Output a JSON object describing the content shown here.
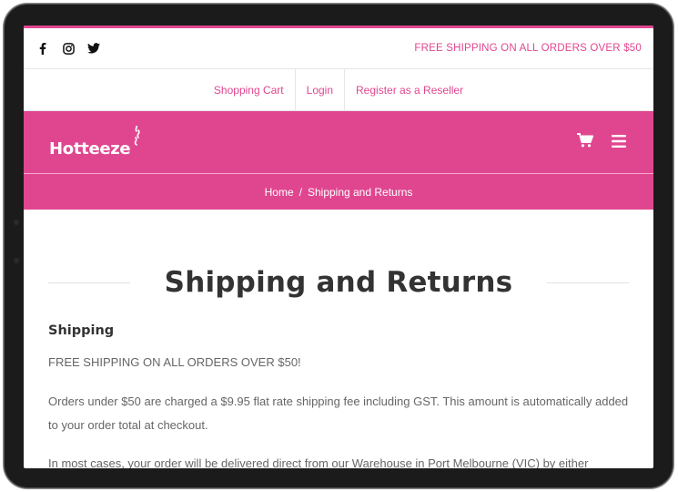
{
  "topbar": {
    "social_icons": [
      "facebook-icon",
      "instagram-icon",
      "twitter-icon"
    ],
    "promo": "FREE SHIPPING ON ALL ORDERS OVER $50"
  },
  "secondary_nav": {
    "items": [
      {
        "label": "Shopping Cart"
      },
      {
        "label": "Login"
      },
      {
        "label": "Register as a Reseller"
      }
    ]
  },
  "header": {
    "logo_text": "Hotteeze",
    "icons": [
      "cart-icon",
      "menu-icon"
    ]
  },
  "breadcrumb": {
    "home": "Home",
    "separator": "/",
    "current": "Shipping and Returns"
  },
  "page": {
    "title": "Shipping and Returns",
    "section_heading": "Shipping",
    "paragraphs": [
      "FREE SHIPPING ON ALL ORDERS OVER $50!",
      "Orders under $50 are charged a $9.95 flat rate shipping fee including GST. This amount is automatically added to your order total at checkout.",
      "In most cases, your order will be delivered direct from our Warehouse in Port Melbourne (VIC) by either"
    ]
  },
  "colors": {
    "brand_pink": "#e0468f",
    "text_dark": "#333333",
    "text_body": "#666666"
  }
}
